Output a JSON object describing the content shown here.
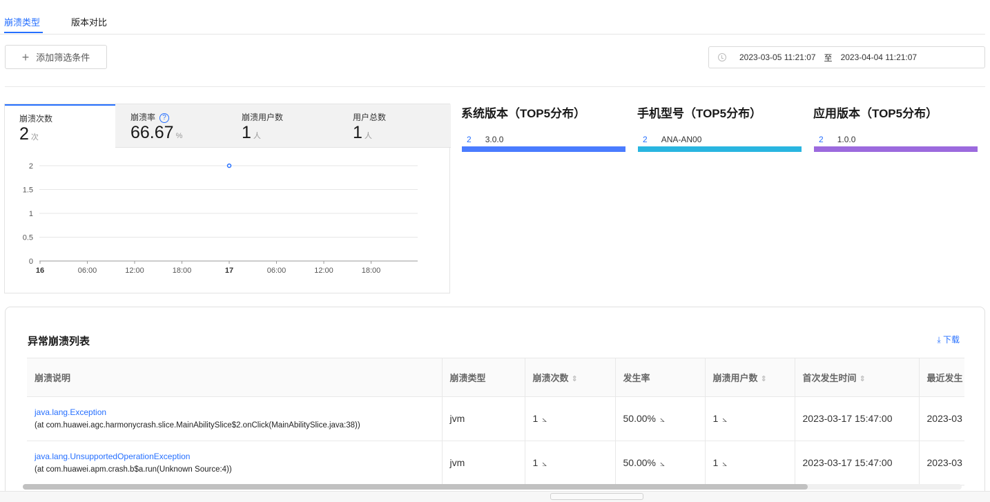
{
  "tabs": [
    {
      "label": "崩溃类型",
      "active": true
    },
    {
      "label": "版本对比",
      "active": false
    }
  ],
  "filter": {
    "add_label": "添加筛选条件"
  },
  "date_range": {
    "start": "2023-03-05 11:21:07",
    "separator": "至",
    "end": "2023-04-04 11:21:07"
  },
  "metrics": [
    {
      "label": "崩溃次数",
      "value": "2",
      "unit": "次",
      "active": true
    },
    {
      "label": "崩溃率",
      "value": "66.67",
      "unit": "%",
      "help": "?"
    },
    {
      "label": "崩溃用户数",
      "value": "1",
      "unit": "人"
    },
    {
      "label": "用户总数",
      "value": "1",
      "unit": "人"
    }
  ],
  "chart_data": {
    "type": "line",
    "title": "",
    "x_ticks": [
      "16",
      "06:00",
      "12:00",
      "18:00",
      "17",
      "06:00",
      "12:00",
      "18:00"
    ],
    "x_tick_bold": [
      true,
      false,
      false,
      false,
      true,
      false,
      false,
      false
    ],
    "y_ticks": [
      "0",
      "0.5",
      "1",
      "1.5",
      "2"
    ],
    "ylim": [
      0,
      2
    ],
    "points": [
      {
        "x": "17 00:00",
        "y": 2
      }
    ],
    "grid": true,
    "color": "#256fff"
  },
  "top5": [
    {
      "title": "系统版本（TOP5分布）",
      "count": "2",
      "name": "3.0.0",
      "color": "#4a7cff"
    },
    {
      "title": "手机型号（TOP5分布）",
      "count": "2",
      "name": "ANA-AN00",
      "color": "#29b5e0"
    },
    {
      "title": "应用版本（TOP5分布）",
      "count": "2",
      "name": "1.0.0",
      "color": "#9c6ade"
    }
  ],
  "crash_list": {
    "title": "异常崩溃列表",
    "download_label": "下载",
    "columns": [
      "崩溃说明",
      "崩溃类型",
      "崩溃次数",
      "发生率",
      "崩溃用户数",
      "首次发生时间",
      "最近发生"
    ],
    "sortable": [
      false,
      false,
      true,
      false,
      true,
      true,
      false
    ],
    "rows": [
      {
        "name": "java.lang.Exception",
        "detail": "(at com.huawei.agc.harmonycrash.slice.MainAbilitySlice$2.onClick(MainAbilitySlice.java:38))",
        "type": "jvm",
        "count": "1",
        "rate": "50.00%",
        "users": "1",
        "first_time": "2023-03-17 15:47:00",
        "last_time": "2023-03"
      },
      {
        "name": "java.lang.UnsupportedOperationException",
        "detail": "(at com.huawei.apm.crash.b$a.run(Unknown Source:4))",
        "type": "jvm",
        "count": "1",
        "rate": "50.00%",
        "users": "1",
        "first_time": "2023-03-17 15:47:00",
        "last_time": "2023-03"
      }
    ]
  },
  "icons": {
    "plus": "plus-icon",
    "clock": "clock-icon",
    "help": "help-circle-icon",
    "download": "download-icon",
    "sort": "sort-icon",
    "trend": "trend-chart-icon"
  }
}
